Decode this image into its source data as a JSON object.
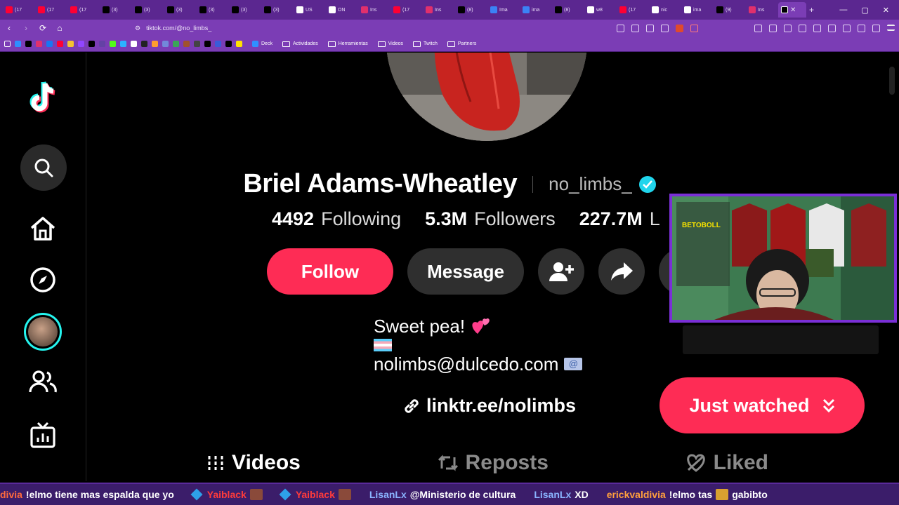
{
  "browser": {
    "tabs": [
      {
        "label": "(17",
        "favicon_color": "#ff0033"
      },
      {
        "label": "(17",
        "favicon_color": "#ff0033"
      },
      {
        "label": "(17",
        "favicon_color": "#ff0033"
      },
      {
        "label": "(3)",
        "favicon_color": "#000000"
      },
      {
        "label": "(3)",
        "favicon_color": "#000000"
      },
      {
        "label": "(3)",
        "favicon_color": "#000000"
      },
      {
        "label": "(3)",
        "favicon_color": "#000000"
      },
      {
        "label": "(3)",
        "favicon_color": "#000000"
      },
      {
        "label": "(3)",
        "favicon_color": "#000000"
      },
      {
        "label": "US",
        "favicon_color": "#ffffff"
      },
      {
        "label": "ON",
        "favicon_color": "#ffffff"
      },
      {
        "label": "Ins",
        "favicon_color": "#e1306c"
      },
      {
        "label": "(17",
        "favicon_color": "#ff0033"
      },
      {
        "label": "Ins",
        "favicon_color": "#e1306c"
      },
      {
        "label": "(8)",
        "favicon_color": "#000000"
      },
      {
        "label": "Ima",
        "favicon_color": "#3b82f6"
      },
      {
        "label": "ima",
        "favicon_color": "#3b82f6"
      },
      {
        "label": "(8)",
        "favicon_color": "#000000"
      },
      {
        "label": "w8",
        "favicon_color": "#ffffff"
      },
      {
        "label": "(17",
        "favicon_color": "#ff0033"
      },
      {
        "label": "nic",
        "favicon_color": "#ffffff"
      },
      {
        "label": "ima",
        "favicon_color": "#ffffff"
      },
      {
        "label": "(9)",
        "favicon_color": "#000000"
      },
      {
        "label": "Ins",
        "favicon_color": "#e1306c"
      }
    ],
    "url": "tiktok.com/@no_limbs_",
    "bookmarks": {
      "folders": [
        "Deck",
        "Actividades",
        "Herramientas",
        "Videos",
        "Twitch",
        "Partners"
      ]
    }
  },
  "profile": {
    "display_name": "Briel Adams-Wheatley",
    "username": "no_limbs_",
    "stats": {
      "following_count": "4492",
      "following_label": "Following",
      "followers_count": "5.3M",
      "followers_label": "Followers",
      "likes_count": "227.7M",
      "likes_label": "L"
    },
    "actions": {
      "follow_label": "Follow",
      "message_label": "Message"
    },
    "bio": {
      "line1": "Sweet pea!",
      "email": "nolimbs@dulcedo.com"
    },
    "link": "linktr.ee/nolimbs",
    "tabs": [
      "Videos",
      "Reposts",
      "Liked"
    ],
    "just_watched_label": "Just watched"
  },
  "chat": [
    {
      "user": "divia",
      "text": "!elmo tiene mas espalda que yo",
      "user_color": "#ff6a3d"
    },
    {
      "user": "Yaiblack",
      "text": "",
      "user_color": "#ff3b3b"
    },
    {
      "user": "Yaiblack",
      "text": "",
      "user_color": "#ff3b3b"
    },
    {
      "user": "LisanLx",
      "text": "@Ministerio de cultura",
      "user_color": "#8ab4ff"
    },
    {
      "user": "LisanLx",
      "text": "XD",
      "user_color": "#8ab4ff"
    },
    {
      "user": "erickvaldivia",
      "text": "!elmo tas",
      "user_color": "#ff9f3d"
    },
    {
      "user": "",
      "text": "gabibto",
      "user_color": "#ffffff"
    }
  ],
  "colors": {
    "tiktok_red": "#fe2c55",
    "verified_blue": "#20d5ec",
    "browser_purple": "#7b3db5"
  }
}
